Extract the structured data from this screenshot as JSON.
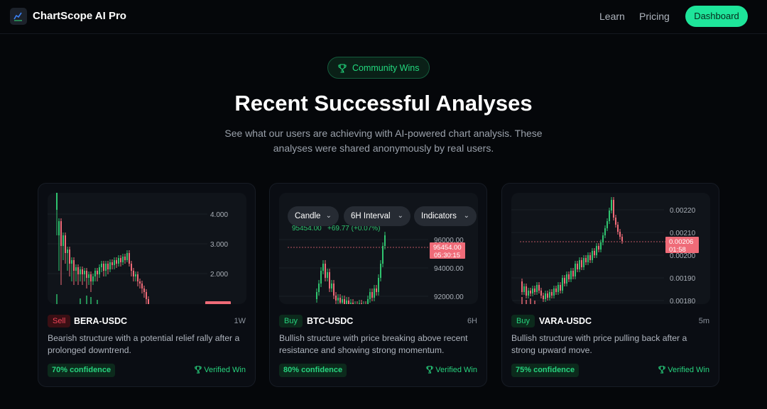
{
  "nav": {
    "brand": "ChartScope AI Pro",
    "links": [
      "Learn",
      "Pricing"
    ],
    "cta": "Dashboard"
  },
  "hero": {
    "badge": "Community Wins",
    "title": "Recent Successful Analyses",
    "subtitle_line1": "See what our users are achieving with AI-powered chart analysis. These",
    "subtitle_line2": "analyses were shared anonymously by real users."
  },
  "colors": {
    "accent": "#1ee59a",
    "up": "#2fc46f",
    "down": "#ef6b78",
    "background": "#05070a"
  },
  "cards": [
    {
      "signal": "Sell",
      "pair": "BERA-USDC",
      "timeframe": "1W",
      "description_line1": "Bearish structure with a potential relief rally after a",
      "description_line2": "prolonged downtrend.",
      "confidence": "70% confidence",
      "verified": "Verified Win",
      "axis": [
        "4.000",
        "3.000",
        "2.000"
      ]
    },
    {
      "signal": "Buy",
      "pair": "BTC-USDC",
      "timeframe": "6H",
      "description_line1": "Bullish structure with price breaking above recent",
      "description_line2": "resistance and showing strong momentum.",
      "confidence": "80% confidence",
      "verified": "Verified Win",
      "toolbar": [
        "Candle",
        "6H Interval",
        "Indicators"
      ],
      "price_line": "95454.00",
      "price_change": "+69.77 (+0.07%)",
      "axis": [
        "96000.00",
        "94000.00",
        "92000.00"
      ],
      "price_tag": "95454.00",
      "countdown": "05:30:15"
    },
    {
      "signal": "Buy",
      "pair": "VARA-USDC",
      "timeframe": "5m",
      "description_line1": "Bullish structure with price pulling back after a",
      "description_line2": "strong upward move.",
      "confidence": "75% confidence",
      "verified": "Verified Win",
      "axis": [
        "0.00220",
        "0.00210",
        "0.00200",
        "0.00190",
        "0.00180"
      ],
      "price_tag": "0.00206",
      "countdown": "01:58"
    }
  ]
}
